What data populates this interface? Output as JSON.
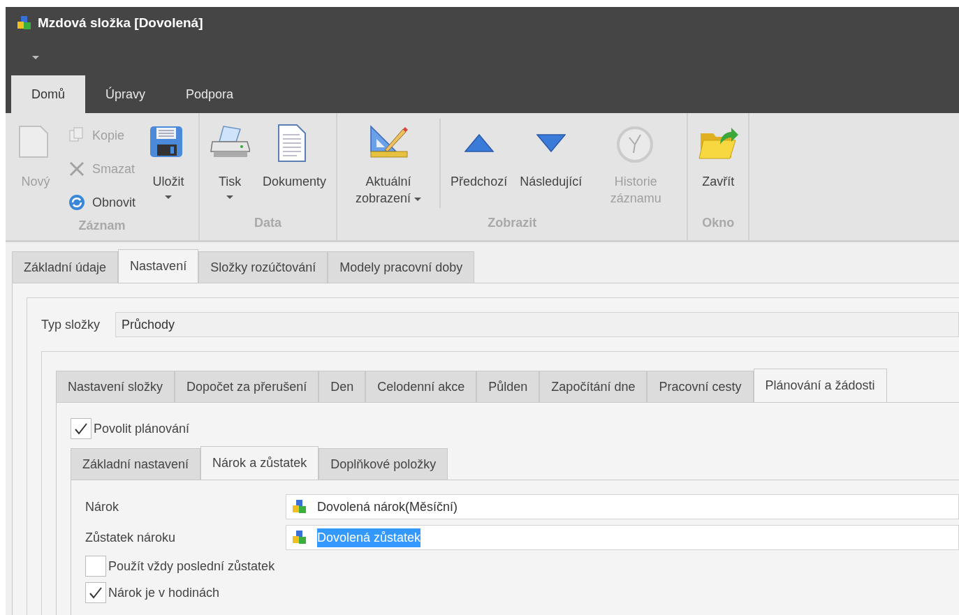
{
  "window": {
    "title": "Mzdová složka [Dovolená]"
  },
  "ribbon_tabs": [
    {
      "label": "Domů",
      "selected": true
    },
    {
      "label": "Úpravy",
      "selected": false
    },
    {
      "label": "Podpora",
      "selected": false
    }
  ],
  "ribbon_groups": [
    {
      "label": "Záznam",
      "items": [
        {
          "kind": "large",
          "label": "Nový",
          "disabled": true,
          "dropdown": false
        },
        {
          "kind": "stack",
          "items": [
            {
              "label": "Kopie",
              "disabled": true
            },
            {
              "label": "Smazat",
              "disabled": true
            },
            {
              "label": "Obnovit",
              "disabled": false
            }
          ]
        },
        {
          "kind": "large",
          "label": "Uložit",
          "disabled": false,
          "dropdown": true
        }
      ]
    },
    {
      "label": "Data",
      "items": [
        {
          "kind": "large",
          "label": "Tisk",
          "disabled": false,
          "dropdown": true
        },
        {
          "kind": "large",
          "label": "Dokumenty",
          "disabled": false,
          "dropdown": false
        }
      ]
    },
    {
      "label": "Zobrazit",
      "items": [
        {
          "kind": "large",
          "label": "Aktuální zobrazení",
          "disabled": false,
          "dropdown": true
        },
        {
          "kind": "separator"
        },
        {
          "kind": "large",
          "label": "Předchozí",
          "disabled": false,
          "dropdown": false
        },
        {
          "kind": "large",
          "label": "Následující",
          "disabled": false,
          "dropdown": false
        },
        {
          "kind": "large",
          "label": "Historie záznamu",
          "disabled": true,
          "dropdown": false
        }
      ]
    },
    {
      "label": "Okno",
      "items": [
        {
          "kind": "large",
          "label": "Zavřít",
          "disabled": false,
          "dropdown": false
        }
      ]
    }
  ],
  "page_tabs": [
    {
      "label": "Základní údaje",
      "selected": false
    },
    {
      "label": "Nastavení",
      "selected": true
    },
    {
      "label": "Složky rozúčtování",
      "selected": false
    },
    {
      "label": "Modely pracovní doby",
      "selected": false
    }
  ],
  "type_field": {
    "label": "Typ složky",
    "value": "Průchody"
  },
  "component_tabs": [
    {
      "label": "Nastavení složky",
      "selected": false
    },
    {
      "label": "Dopočet za přerušení",
      "selected": false
    },
    {
      "label": "Den",
      "selected": false
    },
    {
      "label": "Celodenní akce",
      "selected": false
    },
    {
      "label": "Půlden",
      "selected": false
    },
    {
      "label": "Započítání dne",
      "selected": false
    },
    {
      "label": "Pracovní cesty",
      "selected": false
    },
    {
      "label": "Plánování a žádosti",
      "selected": true
    }
  ],
  "allow_planning": {
    "label": "Povolit plánování",
    "checked": true
  },
  "planning_tabs": [
    {
      "label": "Základní nastavení",
      "selected": false
    },
    {
      "label": "Nárok a zůstatek",
      "selected": true
    },
    {
      "label": "Doplňkové položky",
      "selected": false
    }
  ],
  "fields": [
    {
      "label": "Nárok",
      "value": "Dovolená nárok(Měsíční)",
      "selected": false
    },
    {
      "label": "Zůstatek nároku",
      "value": "Dovolená zůstatek",
      "selected": true
    }
  ],
  "checkboxes": [
    {
      "label": "Použít vždy poslední zůstatek",
      "checked": false
    },
    {
      "label": "Nárok je v hodinách",
      "checked": true
    }
  ]
}
